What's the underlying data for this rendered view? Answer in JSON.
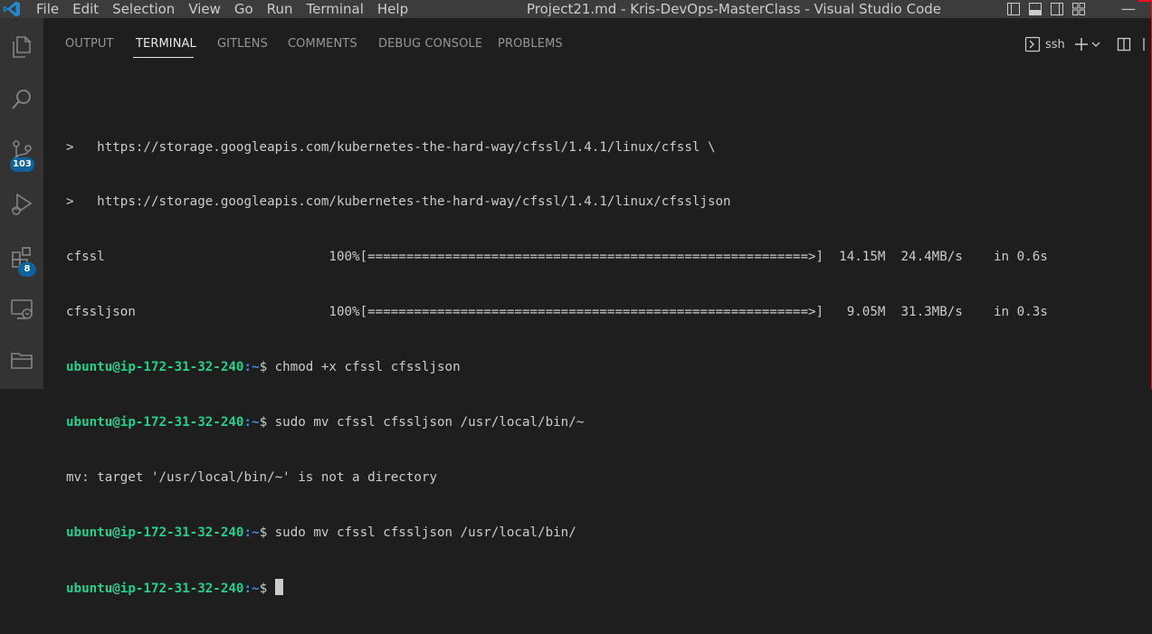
{
  "titlebar": {
    "menu": [
      "File",
      "Edit",
      "Selection",
      "View",
      "Go",
      "Run",
      "Terminal",
      "Help"
    ],
    "window_title": "Project21.md - Kris-DevOps-MasterClass - Visual Studio Code"
  },
  "activity_bar": {
    "items": [
      {
        "name": "explorer",
        "icon": "files-icon"
      },
      {
        "name": "search",
        "icon": "search-icon"
      },
      {
        "name": "source-control",
        "icon": "source-control-icon",
        "badge": "103"
      },
      {
        "name": "run-debug",
        "icon": "run-debug-icon"
      },
      {
        "name": "extensions",
        "icon": "extensions-icon",
        "badge": "8"
      },
      {
        "name": "remote-explorer",
        "icon": "remote-explorer-icon"
      },
      {
        "name": "folder",
        "icon": "folder-icon"
      }
    ]
  },
  "panel": {
    "tabs": [
      "OUTPUT",
      "TERMINAL",
      "GITLENS",
      "COMMENTS",
      "DEBUG CONSOLE",
      "PROBLEMS"
    ],
    "active_tab": "TERMINAL",
    "terminal_profile": "ssh"
  },
  "terminal": {
    "prompt_user": "ubuntu@ip-172-31-32-240",
    "prompt_path": ":~",
    "lines": [
      ">   https://storage.googleapis.com/kubernetes-the-hard-way/cfssl/1.4.1/linux/cfssl \\",
      ">   https://storage.googleapis.com/kubernetes-the-hard-way/cfssl/1.4.1/linux/cfssljson",
      "cfssl                             100%[=========================================================>]  14.15M  24.4MB/s    in 0.6s",
      "cfssljson                         100%[=========================================================>]   9.05M  31.3MB/s    in 0.3s"
    ],
    "commands": [
      "$ chmod +x cfssl cfssljson",
      "$ sudo mv cfssl cfssljson /usr/local/bin/~"
    ],
    "error_line": "mv: target '/usr/local/bin/~' is not a directory",
    "commands2": [
      "$ sudo mv cfssl cfssljson /usr/local/bin/",
      "$ "
    ]
  },
  "colors": {
    "titlebar": "#3c3c3c",
    "activitybar": "#333333",
    "panel": "#1e1e1e",
    "prompt_user": "#23d18b",
    "prompt_path": "#3b8eea",
    "badge": "#0e639c"
  }
}
